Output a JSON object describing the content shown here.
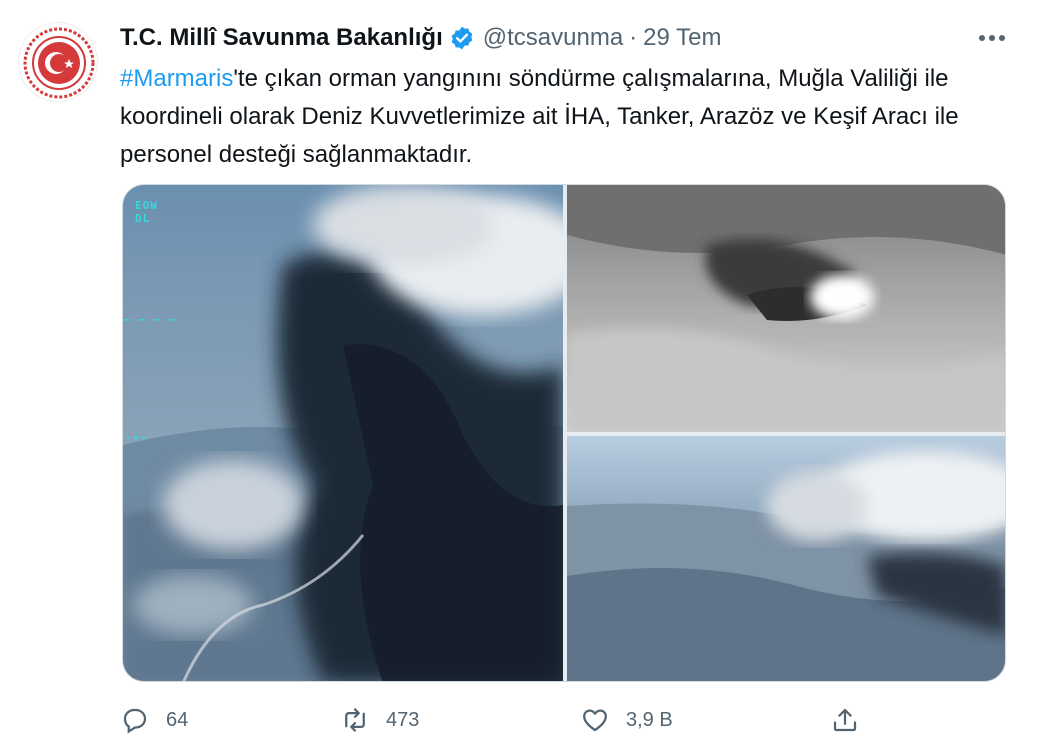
{
  "tweet": {
    "display_name": "T.C. Millî Savunma Bakanlığı",
    "handle": "@tcsavunma",
    "separator": "·",
    "time": "29 Tem",
    "hashtag": "#Marmaris",
    "text": "'te çıkan orman yangınını söndürme çalışmalarına, Muğla Valiliği ile koordineli olarak Deniz Kuvvetlerimize ait İHA, Tanker, Arazöz ve Keşif Aracı ile personel desteği sağlanmaktadır.",
    "verified_icon": "verified-badge-icon",
    "more_icon": "more-dots-icon",
    "brand_color": "#1d9bf0"
  },
  "actions": {
    "reply": {
      "icon": "reply-icon",
      "count": "64"
    },
    "retweet": {
      "icon": "retweet-icon",
      "count": "473"
    },
    "like": {
      "icon": "heart-icon",
      "count": "3,9 B"
    },
    "share": {
      "icon": "share-icon"
    }
  }
}
